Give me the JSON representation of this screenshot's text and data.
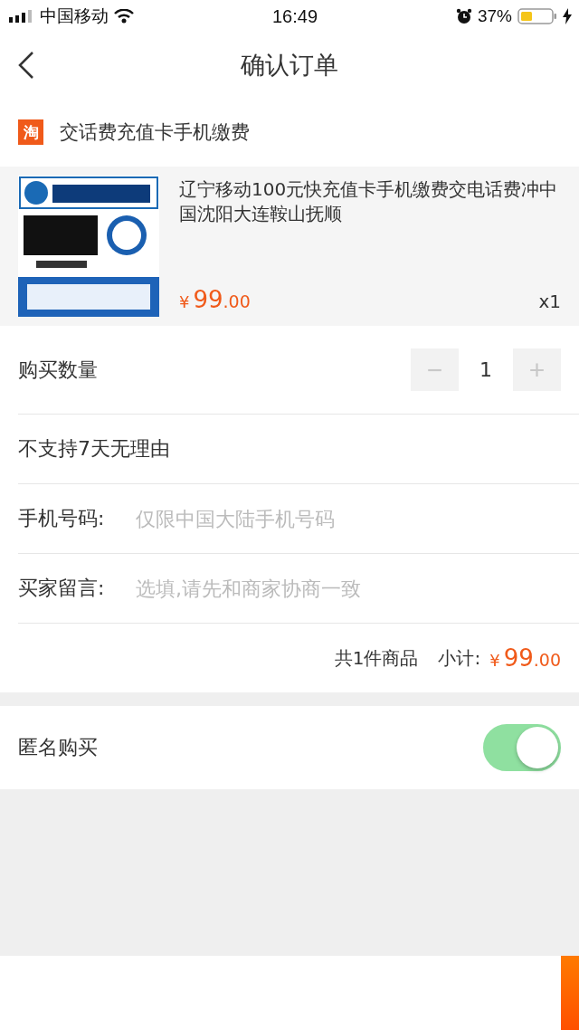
{
  "status_bar": {
    "carrier": "中国移动",
    "time": "16:49",
    "battery": "37%"
  },
  "nav": {
    "title": "确认订单"
  },
  "shop": {
    "name": "交话费充值卡手机缴费",
    "badge": "淘"
  },
  "product": {
    "title": "辽宁移动100元快充值卡手机缴费交电话费冲中国沈阳大连鞍山抚顺",
    "currency": "¥",
    "price_int": "99",
    "price_dec": ".00",
    "quantity": "x1"
  },
  "quantity_row": {
    "label": "购买数量",
    "minus": "−",
    "value": "1",
    "plus": "+",
    "minus_disabled": true
  },
  "notice": "不支持7天无理由",
  "fields": [
    {
      "label": "手机号码:",
      "placeholder": "仅限中国大陆手机号码"
    },
    {
      "label": "买家留言:",
      "placeholder": "选填,请先和商家协商一致"
    }
  ],
  "summary": {
    "count": "共1件商品",
    "label": "小计:",
    "currency": "¥",
    "price_int": "99",
    "price_dec": ".00"
  },
  "anonymous": {
    "label": "匿名购买",
    "on": true
  }
}
